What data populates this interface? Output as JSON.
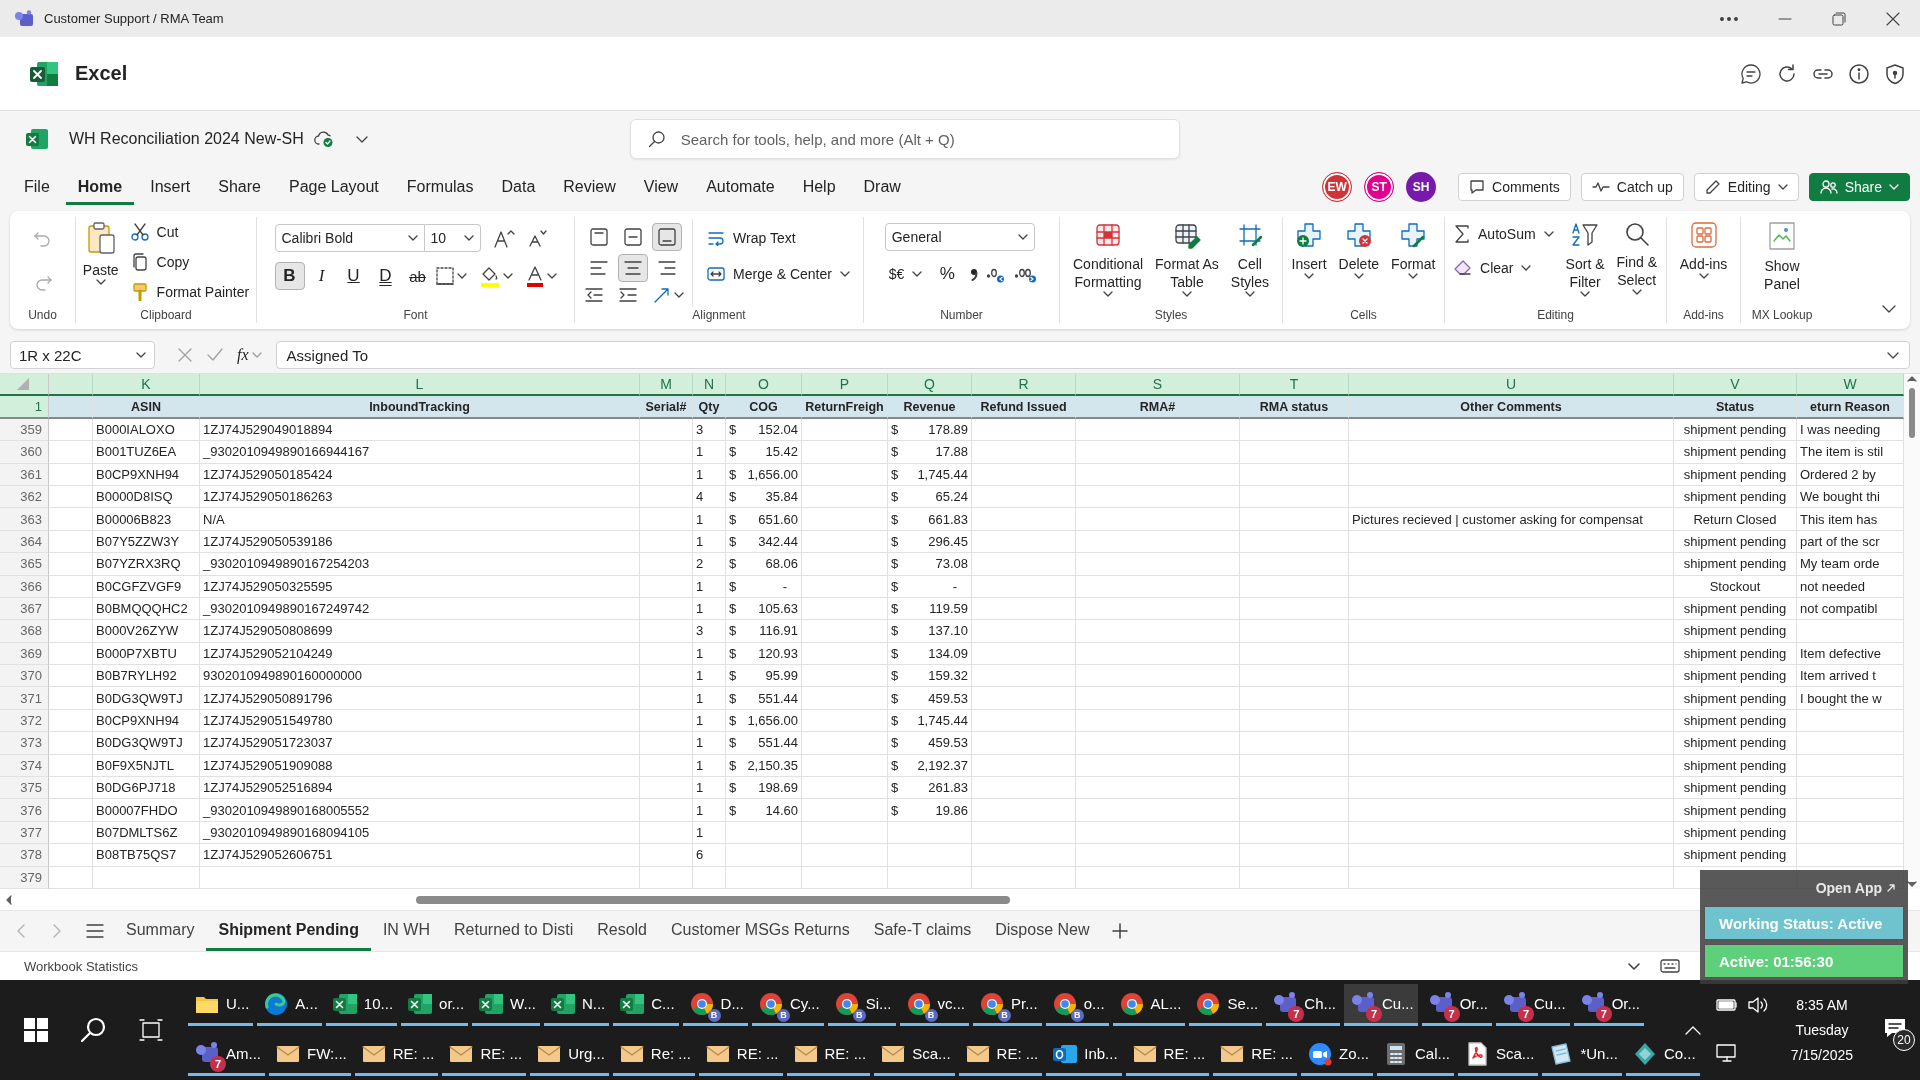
{
  "title_bar": {
    "title": "Customer Support / RMA Team"
  },
  "app_header": {
    "app_name": "Excel"
  },
  "document": {
    "file_name": "WH Reconciliation 2024 New-SH"
  },
  "search": {
    "placeholder": "Search for tools, help, and more (Alt + Q)"
  },
  "menu_tabs": [
    {
      "label": "File",
      "selected": false
    },
    {
      "label": "Home",
      "selected": true
    },
    {
      "label": "Insert",
      "selected": false
    },
    {
      "label": "Share",
      "selected": false
    },
    {
      "label": "Page Layout",
      "selected": false
    },
    {
      "label": "Formulas",
      "selected": false
    },
    {
      "label": "Data",
      "selected": false
    },
    {
      "label": "Review",
      "selected": false
    },
    {
      "label": "View",
      "selected": false
    },
    {
      "label": "Automate",
      "selected": false
    },
    {
      "label": "Help",
      "selected": false
    },
    {
      "label": "Draw",
      "selected": false
    }
  ],
  "collaborators": [
    {
      "initials": "EW",
      "color": "#d13438"
    },
    {
      "initials": "ST",
      "color": "#e3008c"
    },
    {
      "initials": "SH",
      "color": "#7719aa"
    }
  ],
  "header_buttons": [
    {
      "label": "Comments",
      "kind": "plain"
    },
    {
      "label": "Catch up",
      "kind": "plain"
    },
    {
      "label": "Editing",
      "kind": "menu"
    },
    {
      "label": "Share",
      "kind": "primary"
    }
  ],
  "ribbon": {
    "undo": {
      "label": "Undo",
      "buttons": [
        {
          "disabled": true
        },
        {
          "disabled": true
        }
      ]
    },
    "clipboard": {
      "label": "Clipboard",
      "paste": "Paste",
      "commands": [
        "Cut",
        "Copy",
        "Format Painter"
      ]
    },
    "font": {
      "label": "Font",
      "font_name": "Calibri Bold",
      "font_size": "10",
      "styles": [
        {
          "glyph": "B",
          "selected": true
        },
        {
          "glyph": "I",
          "selected": false
        },
        {
          "glyph": "U",
          "selected": false
        },
        {
          "glyph": "D",
          "selected": false
        },
        {
          "glyph": "ab",
          "selected": false
        }
      ]
    },
    "alignment": {
      "label": "Alignment",
      "vertical": [
        {
          "selected": false
        },
        {
          "selected": false
        },
        {
          "selected": true
        }
      ],
      "horizontal": [
        {
          "selected": false
        },
        {
          "selected": true
        },
        {
          "selected": false
        }
      ],
      "commands": [
        "Wrap Text",
        "Merge & Center"
      ]
    },
    "number": {
      "label": "Number",
      "format": "General",
      "currency": "$€",
      "percent": "%"
    },
    "styles": {
      "label": "Styles",
      "commands": [
        {
          "lines": [
            "Conditional",
            "Formatting"
          ],
          "dropdown": true
        },
        {
          "lines": [
            "Format As",
            "Table"
          ],
          "dropdown": true
        },
        {
          "lines": [
            "Cell",
            "Styles"
          ],
          "dropdown": true
        }
      ]
    },
    "cells": {
      "label": "Cells",
      "commands": [
        {
          "lines": [
            "Insert"
          ],
          "dropdown": true
        },
        {
          "lines": [
            "Delete"
          ],
          "dropdown": true
        },
        {
          "lines": [
            "Format"
          ],
          "dropdown": true
        }
      ]
    },
    "editing": {
      "label": "Editing",
      "small": [
        "AutoSum",
        "Clear"
      ],
      "commands": [
        {
          "lines": [
            "Sort &",
            "Filter"
          ],
          "dropdown": true
        },
        {
          "lines": [
            "Find &",
            "Select"
          ],
          "dropdown": true
        }
      ]
    },
    "addins": {
      "label": "Add-ins",
      "commands": [
        {
          "lines": [
            "Add-ins"
          ],
          "dropdown": true
        }
      ]
    },
    "mx_lookup": {
      "label": "MX Lookup",
      "commands": [
        {
          "lines": [
            "Show",
            "Panel"
          ],
          "dropdown": false
        }
      ]
    }
  },
  "formula_bar": {
    "name_box": "1R x 22C",
    "function_label": "fx",
    "value": "Assigned To"
  },
  "sheet": {
    "columns": [
      {
        "kind": "blank"
      },
      {
        "letter": "K",
        "heading": "ASIN",
        "kind": "text"
      },
      {
        "letter": "L",
        "heading": "InboundTracking",
        "kind": "text"
      },
      {
        "letter": "M",
        "heading": "Serial#",
        "kind": "text"
      },
      {
        "letter": "N",
        "heading": "Qty",
        "kind": "text"
      },
      {
        "letter": "O",
        "heading": "COG",
        "kind": "currency"
      },
      {
        "letter": "P",
        "heading": "ReturnFreigh",
        "kind": "currency"
      },
      {
        "letter": "Q",
        "heading": "Revenue",
        "kind": "currency"
      },
      {
        "letter": "R",
        "heading": "Refund Issued",
        "kind": "text"
      },
      {
        "letter": "S",
        "heading": "RMA#",
        "kind": "text"
      },
      {
        "letter": "T",
        "heading": "RMA status",
        "kind": "text"
      },
      {
        "letter": "U",
        "heading": "Other Comments",
        "kind": "text"
      },
      {
        "letter": "V",
        "heading": "Status",
        "kind": "center"
      },
      {
        "letter": "W",
        "heading": "eturn Reason",
        "kind": "text"
      }
    ],
    "header_row": "1",
    "rows": [
      {
        "number": "359",
        "cells": {
          "K": "B000IALOXO",
          "L": "1ZJ74J529049018894",
          "N": "3",
          "O": {
            "symbol": "$",
            "amount": "152.04"
          },
          "Q": {
            "symbol": "$",
            "amount": "178.89"
          },
          "V": "shipment pending",
          "W": "I was needing"
        }
      },
      {
        "number": "360",
        "cells": {
          "K": "B001TUZ6EA",
          "L": "_9302010949890166944167",
          "N": "1",
          "O": {
            "symbol": "$",
            "amount": "15.42"
          },
          "Q": {
            "symbol": "$",
            "amount": "17.88"
          },
          "V": "shipment pending",
          "W": "The item is stil"
        }
      },
      {
        "number": "361",
        "cells": {
          "K": "B0CP9XNH94",
          "L": "1ZJ74J529050185424",
          "N": "1",
          "O": {
            "symbol": "$",
            "amount": "1,656.00"
          },
          "Q": {
            "symbol": "$",
            "amount": "1,745.44"
          },
          "V": "shipment pending",
          "W": "Ordered 2 by"
        }
      },
      {
        "number": "362",
        "cells": {
          "K": "B0000D8ISQ",
          "L": "1ZJ74J529050186263",
          "N": "4",
          "O": {
            "symbol": "$",
            "amount": "35.84"
          },
          "Q": {
            "symbol": "$",
            "amount": "65.24"
          },
          "V": "shipment pending",
          "W": "We bought thi"
        }
      },
      {
        "number": "363",
        "cells": {
          "K": "B00006B823",
          "L": "N/A",
          "N": "1",
          "O": {
            "symbol": "$",
            "amount": "651.60"
          },
          "Q": {
            "symbol": "$",
            "amount": "661.83"
          },
          "U": "Pictures recieved | customer asking for compensat",
          "V": "Return Closed",
          "W": "This item has"
        }
      },
      {
        "number": "364",
        "cells": {
          "K": "B07Y5ZZW3Y",
          "L": "1ZJ74J529050539186",
          "N": "1",
          "O": {
            "symbol": "$",
            "amount": "342.44"
          },
          "Q": {
            "symbol": "$",
            "amount": "296.45"
          },
          "V": "shipment pending",
          "W": "part of the scr"
        }
      },
      {
        "number": "365",
        "cells": {
          "K": "B07YZRX3RQ",
          "L": "_9302010949890167254203",
          "N": "2",
          "O": {
            "symbol": "$",
            "amount": "68.06"
          },
          "Q": {
            "symbol": "$",
            "amount": "73.08"
          },
          "V": "shipment pending",
          "W": "My team orde"
        }
      },
      {
        "number": "366",
        "cells": {
          "K": "B0CGFZVGF9",
          "L": "1ZJ74J529050325595",
          "N": "1",
          "O": {
            "symbol": "$",
            "amount": "-"
          },
          "Q": {
            "symbol": "$",
            "amount": "-"
          },
          "V": "Stockout",
          "W": "not needed"
        }
      },
      {
        "number": "367",
        "cells": {
          "K": "B0BMQQQHC2",
          "L": "_9302010949890167249742",
          "N": "1",
          "O": {
            "symbol": "$",
            "amount": "105.63"
          },
          "Q": {
            "symbol": "$",
            "amount": "119.59"
          },
          "V": "shipment pending",
          "W": "not compatibl"
        }
      },
      {
        "number": "368",
        "cells": {
          "K": "B000V26ZYW",
          "L": "1ZJ74J529050808699",
          "N": "3",
          "O": {
            "symbol": "$",
            "amount": "116.91"
          },
          "Q": {
            "symbol": "$",
            "amount": "137.10"
          },
          "V": "shipment pending"
        }
      },
      {
        "number": "369",
        "cells": {
          "K": "B000P7XBTU",
          "L": "1ZJ74J529052104249",
          "N": "1",
          "O": {
            "symbol": "$",
            "amount": "120.93"
          },
          "Q": {
            "symbol": "$",
            "amount": "134.09"
          },
          "V": "shipment pending",
          "W": "Item defective"
        }
      },
      {
        "number": "370",
        "cells": {
          "K": "B0B7RYLH92",
          "L": "9302010949890160000000",
          "N": "1",
          "O": {
            "symbol": "$",
            "amount": "95.99"
          },
          "Q": {
            "symbol": "$",
            "amount": "159.32"
          },
          "V": "shipment pending",
          "W": "Item arrived t"
        }
      },
      {
        "number": "371",
        "cells": {
          "K": "B0DG3QW9TJ",
          "L": "1ZJ74J529050891796",
          "N": "1",
          "O": {
            "symbol": "$",
            "amount": "551.44"
          },
          "Q": {
            "symbol": "$",
            "amount": "459.53"
          },
          "V": "shipment pending",
          "W": "I bought the w"
        }
      },
      {
        "number": "372",
        "cells": {
          "K": "B0CP9XNH94",
          "L": "1ZJ74J529051549780",
          "N": "1",
          "O": {
            "symbol": "$",
            "amount": "1,656.00"
          },
          "Q": {
            "symbol": "$",
            "amount": "1,745.44"
          },
          "V": "shipment pending"
        }
      },
      {
        "number": "373",
        "cells": {
          "K": "B0DG3QW9TJ",
          "L": "1ZJ74J529051723037",
          "N": "1",
          "O": {
            "symbol": "$",
            "amount": "551.44"
          },
          "Q": {
            "symbol": "$",
            "amount": "459.53"
          },
          "V": "shipment pending"
        }
      },
      {
        "number": "374",
        "cells": {
          "K": "B0F9X5NJTL",
          "L": "1ZJ74J529051909088",
          "N": "1",
          "O": {
            "symbol": "$",
            "amount": "2,150.35"
          },
          "Q": {
            "symbol": "$",
            "amount": "2,192.37"
          },
          "V": "shipment pending"
        }
      },
      {
        "number": "375",
        "cells": {
          "K": "B0DG6PJ718",
          "L": "1ZJ74J529052516894",
          "N": "1",
          "O": {
            "symbol": "$",
            "amount": "198.69"
          },
          "Q": {
            "symbol": "$",
            "amount": "261.83"
          },
          "V": "shipment pending"
        }
      },
      {
        "number": "376",
        "cells": {
          "K": "B00007FHDO",
          "L": "_9302010949890168005552",
          "N": "1",
          "O": {
            "symbol": "$",
            "amount": "14.60"
          },
          "Q": {
            "symbol": "$",
            "amount": "19.86"
          },
          "V": "shipment pending"
        }
      },
      {
        "number": "377",
        "cells": {
          "K": "B07DMLTS6Z",
          "L": "_9302010949890168094105",
          "N": "1",
          "V": "shipment pending"
        }
      },
      {
        "number": "378",
        "cells": {
          "K": "B08TB75QS7",
          "L": "1ZJ74J529052606751",
          "N": "6",
          "V": "shipment pending"
        }
      },
      {
        "number": "379",
        "cells": {}
      }
    ]
  },
  "sheet_tabs": [
    {
      "label": "Summary",
      "selected": false
    },
    {
      "label": "Shipment Pending",
      "selected": true
    },
    {
      "label": "IN WH",
      "selected": false
    },
    {
      "label": "Returned to Disti",
      "selected": false
    },
    {
      "label": "Resold",
      "selected": false
    },
    {
      "label": "Customer MSGs Returns",
      "selected": false
    },
    {
      "label": "Safe-T claims",
      "selected": false
    },
    {
      "label": "Dispose New",
      "selected": false
    }
  ],
  "status_bar": {
    "text": "Workbook Statistics"
  },
  "overlay": {
    "open_app": "Open App",
    "working_status": "Working Status: Active",
    "active_time": "Active: 01:56:30"
  },
  "taskbar": {
    "top_row": [
      {
        "label": "U...",
        "kind": "folder",
        "selected": false
      },
      {
        "label": "A...",
        "kind": "edge",
        "selected": false
      },
      {
        "label": "10...",
        "kind": "excel",
        "selected": false
      },
      {
        "label": "or...",
        "kind": "excel",
        "selected": false
      },
      {
        "label": "W...",
        "kind": "excel",
        "selected": false
      },
      {
        "label": "N...",
        "kind": "excel",
        "selected": false
      },
      {
        "label": "C...",
        "kind": "excel",
        "selected": false
      },
      {
        "label": "D...",
        "kind": "chrome",
        "badge": "B",
        "selected": false
      },
      {
        "label": "Cy...",
        "kind": "chrome",
        "badge": "B",
        "selected": false
      },
      {
        "label": "Si...",
        "kind": "chrome",
        "badge": "B",
        "selected": false
      },
      {
        "label": "vc...",
        "kind": "chrome",
        "badge": "B",
        "selected": false
      },
      {
        "label": "Pr...",
        "kind": "chrome",
        "badge": "B",
        "selected": false
      },
      {
        "label": "o...",
        "kind": "chrome",
        "badge": "B",
        "selected": false
      },
      {
        "label": "AL...",
        "kind": "chrome",
        "selected": false
      },
      {
        "label": "Se...",
        "kind": "chrome",
        "selected": false
      },
      {
        "label": "Ch...",
        "kind": "teams",
        "badge": "7",
        "selected": false
      },
      {
        "label": "Cu...",
        "kind": "teams",
        "badge": "7",
        "selected": true
      },
      {
        "label": "Or...",
        "kind": "teams",
        "badge": "7",
        "selected": false
      },
      {
        "label": "Cu...",
        "kind": "teams",
        "badge": "7",
        "selected": false
      },
      {
        "label": "Or...",
        "kind": "teams",
        "badge": "7",
        "selected": false
      }
    ],
    "bottom_row": [
      {
        "label": "Am...",
        "kind": "teams",
        "badge": "7",
        "selected": false
      },
      {
        "label": "FW:...",
        "kind": "mail",
        "selected": false
      },
      {
        "label": "RE: ...",
        "kind": "mail",
        "selected": false
      },
      {
        "label": "RE: ...",
        "kind": "mail",
        "selected": false
      },
      {
        "label": "Urg...",
        "kind": "mail",
        "selected": false
      },
      {
        "label": "Re: ...",
        "kind": "mail",
        "selected": false
      },
      {
        "label": "RE: ...",
        "kind": "mail",
        "selected": false
      },
      {
        "label": "RE: ...",
        "kind": "mail",
        "selected": false
      },
      {
        "label": "Sca...",
        "kind": "mail",
        "selected": false
      },
      {
        "label": "RE: ...",
        "kind": "mail",
        "selected": false
      },
      {
        "label": "Inb...",
        "kind": "outlook",
        "selected": false
      },
      {
        "label": "RE: ...",
        "kind": "mail",
        "selected": false
      },
      {
        "label": "RE: ...",
        "kind": "mail",
        "selected": false
      },
      {
        "label": "Zo...",
        "kind": "zoom",
        "selected": false
      },
      {
        "label": "Cal...",
        "kind": "calculator",
        "selected": false
      },
      {
        "label": "Sca...",
        "kind": "pdf",
        "selected": false
      },
      {
        "label": "*Un...",
        "kind": "notepad",
        "selected": false
      },
      {
        "label": "Co...",
        "kind": "app",
        "selected": false
      }
    ],
    "clock": {
      "time": "8:35 AM",
      "day": "Tuesday",
      "date": "7/15/2025"
    },
    "notifications": "20"
  }
}
